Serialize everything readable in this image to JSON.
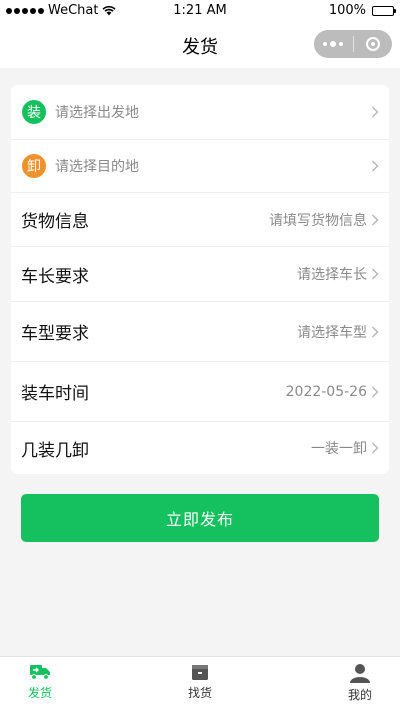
{
  "status_bar": {
    "carrier": "WeChat",
    "time": "1:21 AM",
    "battery": "100%"
  },
  "nav": {
    "title": "发货"
  },
  "locations": {
    "origin": {
      "badge": "装",
      "placeholder": "请选择出发地",
      "badge_color": "#15c05e"
    },
    "destination": {
      "badge": "卸",
      "placeholder": "请选择目的地",
      "badge_color": "#f0912b"
    }
  },
  "form_rows": [
    {
      "label": "货物信息",
      "value": "请填写货物信息"
    },
    {
      "label": "车长要求",
      "value": "请选择车长"
    },
    {
      "label": "车型要求",
      "value": "请选择车型"
    },
    {
      "label": "装车时间",
      "value": "2022-05-26"
    },
    {
      "label": "几装几卸",
      "value": "一装一卸"
    }
  ],
  "publish_button": {
    "label": "立即发布",
    "color": "#15c05e"
  },
  "tab_bar": {
    "active_color": "#15c05e",
    "inactive_color": "#333333",
    "tabs": [
      {
        "label": "发货",
        "icon": "truck-icon",
        "active": true
      },
      {
        "label": "找货",
        "icon": "box-icon",
        "active": false
      },
      {
        "label": "我的",
        "icon": "user-icon",
        "active": false
      }
    ]
  }
}
